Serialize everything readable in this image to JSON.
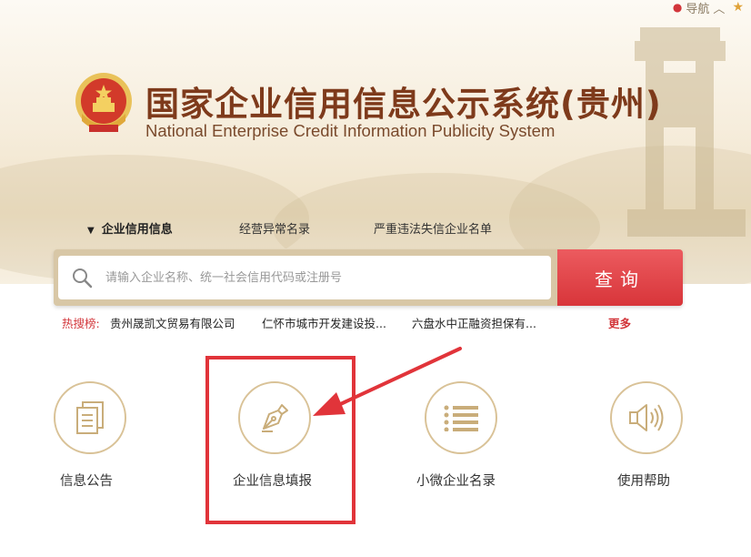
{
  "top_nav": {
    "label": "导航",
    "chevron": "︿",
    "icons": [
      "location-pin-icon",
      "star-icon"
    ]
  },
  "header": {
    "title_cn": "国家企业信用信息公示系统(贵州)",
    "title_en": "National Enterprise Credit Information Publicity System"
  },
  "tabs": [
    {
      "label": "企业信用信息",
      "active": true
    },
    {
      "label": "经营异常名录",
      "active": false
    },
    {
      "label": "严重违法失信企业名单",
      "active": false
    }
  ],
  "search": {
    "placeholder": "请输入企业名称、统一社会信用代码或注册号",
    "button_label": "查询"
  },
  "hot_search": {
    "label": "热搜榜:",
    "items": [
      "贵州晟凯文贸易有限公司",
      "仁怀市城市开发建设投...",
      "六盘水中正融资担保有..."
    ],
    "more_label": "更多"
  },
  "features": [
    {
      "label": "信息公告",
      "icon": "document-icon"
    },
    {
      "label": "企业信息填报",
      "icon": "pen-nib-icon"
    },
    {
      "label": "小微企业名录",
      "icon": "list-icon"
    },
    {
      "label": "使用帮助",
      "icon": "speaker-icon"
    }
  ],
  "colors": {
    "accent_red": "#d8353a",
    "title_brown": "#7e3a1b",
    "ring_gold": "#d9c297",
    "highlight_red": "#e1343a"
  }
}
